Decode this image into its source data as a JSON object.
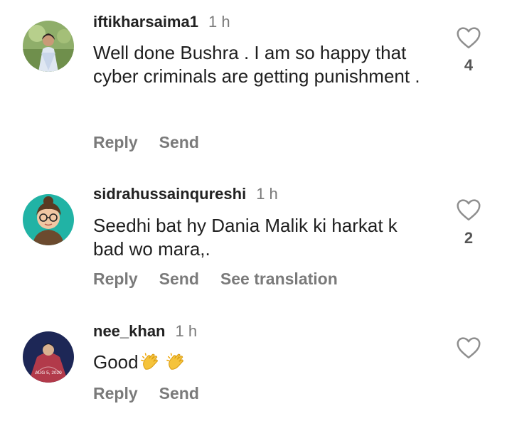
{
  "comments": [
    {
      "username": "iftikharsaima1",
      "time": "1 h",
      "text": "Well done Bushra . I am so happy that cyber criminals are getting punishment .",
      "likes": "4",
      "actions": {
        "reply": "Reply",
        "send": "Send"
      }
    },
    {
      "username": "sidrahussainqureshi",
      "time": "1 h",
      "text": "Seedhi bat hy Dania Malik ki harkat k bad wo mara,.",
      "likes": "2",
      "actions": {
        "reply": "Reply",
        "send": "Send",
        "translate": "See translation"
      }
    },
    {
      "username": "nee_khan",
      "time": "1 h",
      "text": "Good",
      "emojis": [
        "clapping-hands",
        "clapping-hands"
      ],
      "likes": "",
      "avatar_caption": "AUG 5, 2020",
      "actions": {
        "reply": "Reply",
        "send": "Send"
      }
    }
  ]
}
